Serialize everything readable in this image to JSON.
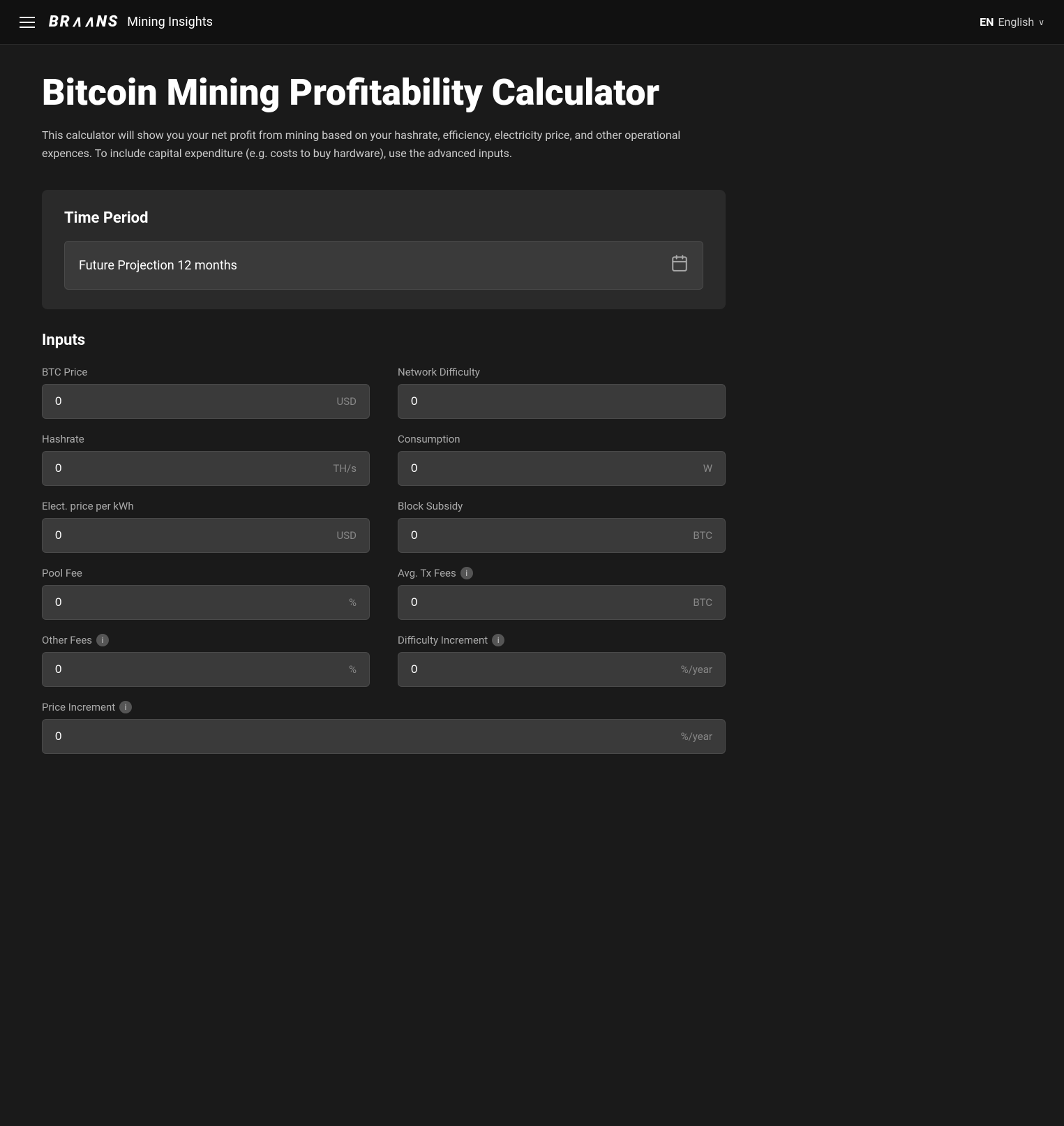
{
  "navbar": {
    "menu_icon": "hamburger-icon",
    "brand_logo": "BR‹›IIINS",
    "brand_name": "Mining Insights",
    "lang_code": "EN",
    "lang_name": "English",
    "chevron": "∨"
  },
  "page": {
    "title": "Bitcoin Mining Profitability Calculator",
    "description": "This calculator will show you your net profit from mining based on your hashrate, efficiency, electricity price, and other operational expences. To include capital expenditure (e.g. costs to buy hardware), use the advanced inputs."
  },
  "time_period": {
    "section_title": "Time Period",
    "selected_value": "Future Projection 12 months",
    "calendar_symbol": "📅"
  },
  "inputs": {
    "section_title": "Inputs",
    "fields": [
      {
        "label": "BTC Price",
        "value": "0",
        "unit": "USD",
        "info": false,
        "id": "btc-price"
      },
      {
        "label": "Network Difficulty",
        "value": "0",
        "unit": "",
        "info": false,
        "id": "network-difficulty"
      },
      {
        "label": "Hashrate",
        "value": "0",
        "unit": "TH/s",
        "info": false,
        "id": "hashrate"
      },
      {
        "label": "Consumption",
        "value": "0",
        "unit": "W",
        "info": false,
        "id": "consumption"
      },
      {
        "label": "Elect. price per kWh",
        "value": "0",
        "unit": "USD",
        "info": false,
        "id": "elec-price"
      },
      {
        "label": "Block Subsidy",
        "value": "0",
        "unit": "BTC",
        "info": false,
        "id": "block-subsidy"
      },
      {
        "label": "Pool Fee",
        "value": "0",
        "unit": "%",
        "info": false,
        "id": "pool-fee"
      },
      {
        "label": "Avg. Tx Fees",
        "value": "0",
        "unit": "BTC",
        "info": true,
        "id": "avg-tx-fees"
      },
      {
        "label": "Other Fees",
        "value": "0",
        "unit": "%",
        "info": true,
        "id": "other-fees"
      },
      {
        "label": "Difficulty Increment",
        "value": "0",
        "unit": "%/year",
        "info": true,
        "id": "difficulty-increment"
      },
      {
        "label": "Price Increment",
        "value": "0",
        "unit": "%/year",
        "info": true,
        "id": "price-increment",
        "full_width": true
      }
    ]
  }
}
